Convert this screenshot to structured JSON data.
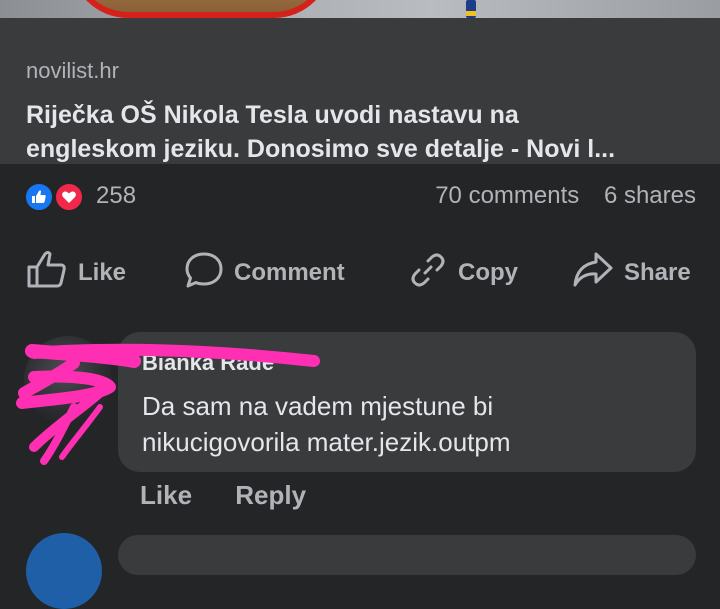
{
  "link": {
    "domain": "novilist.hr",
    "title_line1": "Riječka OŠ Nikola Tesla uvodi nastavu na",
    "title_line2": "engleskom jeziku. Donosimo sve detalje - Novi l..."
  },
  "stats": {
    "reaction_icons": [
      "like-icon",
      "love-icon"
    ],
    "reaction_count": "258",
    "comments": "70 comments",
    "shares": "6 shares"
  },
  "actions": {
    "like": "Like",
    "comment": "Comment",
    "copy": "Copy",
    "share": "Share"
  },
  "comment": {
    "author": "Bianka Rade",
    "line1": "Da sam na vadem mjestune bi",
    "line2": "nikucigovorila  mater.jezik.outpm",
    "like": "Like",
    "reply": "Reply"
  },
  "colors": {
    "background": "#242526",
    "card": "#3a3b3c",
    "like_blue": "#1877f2",
    "love_red": "#f0284a",
    "scribble_pink": "#ff2fb3"
  }
}
